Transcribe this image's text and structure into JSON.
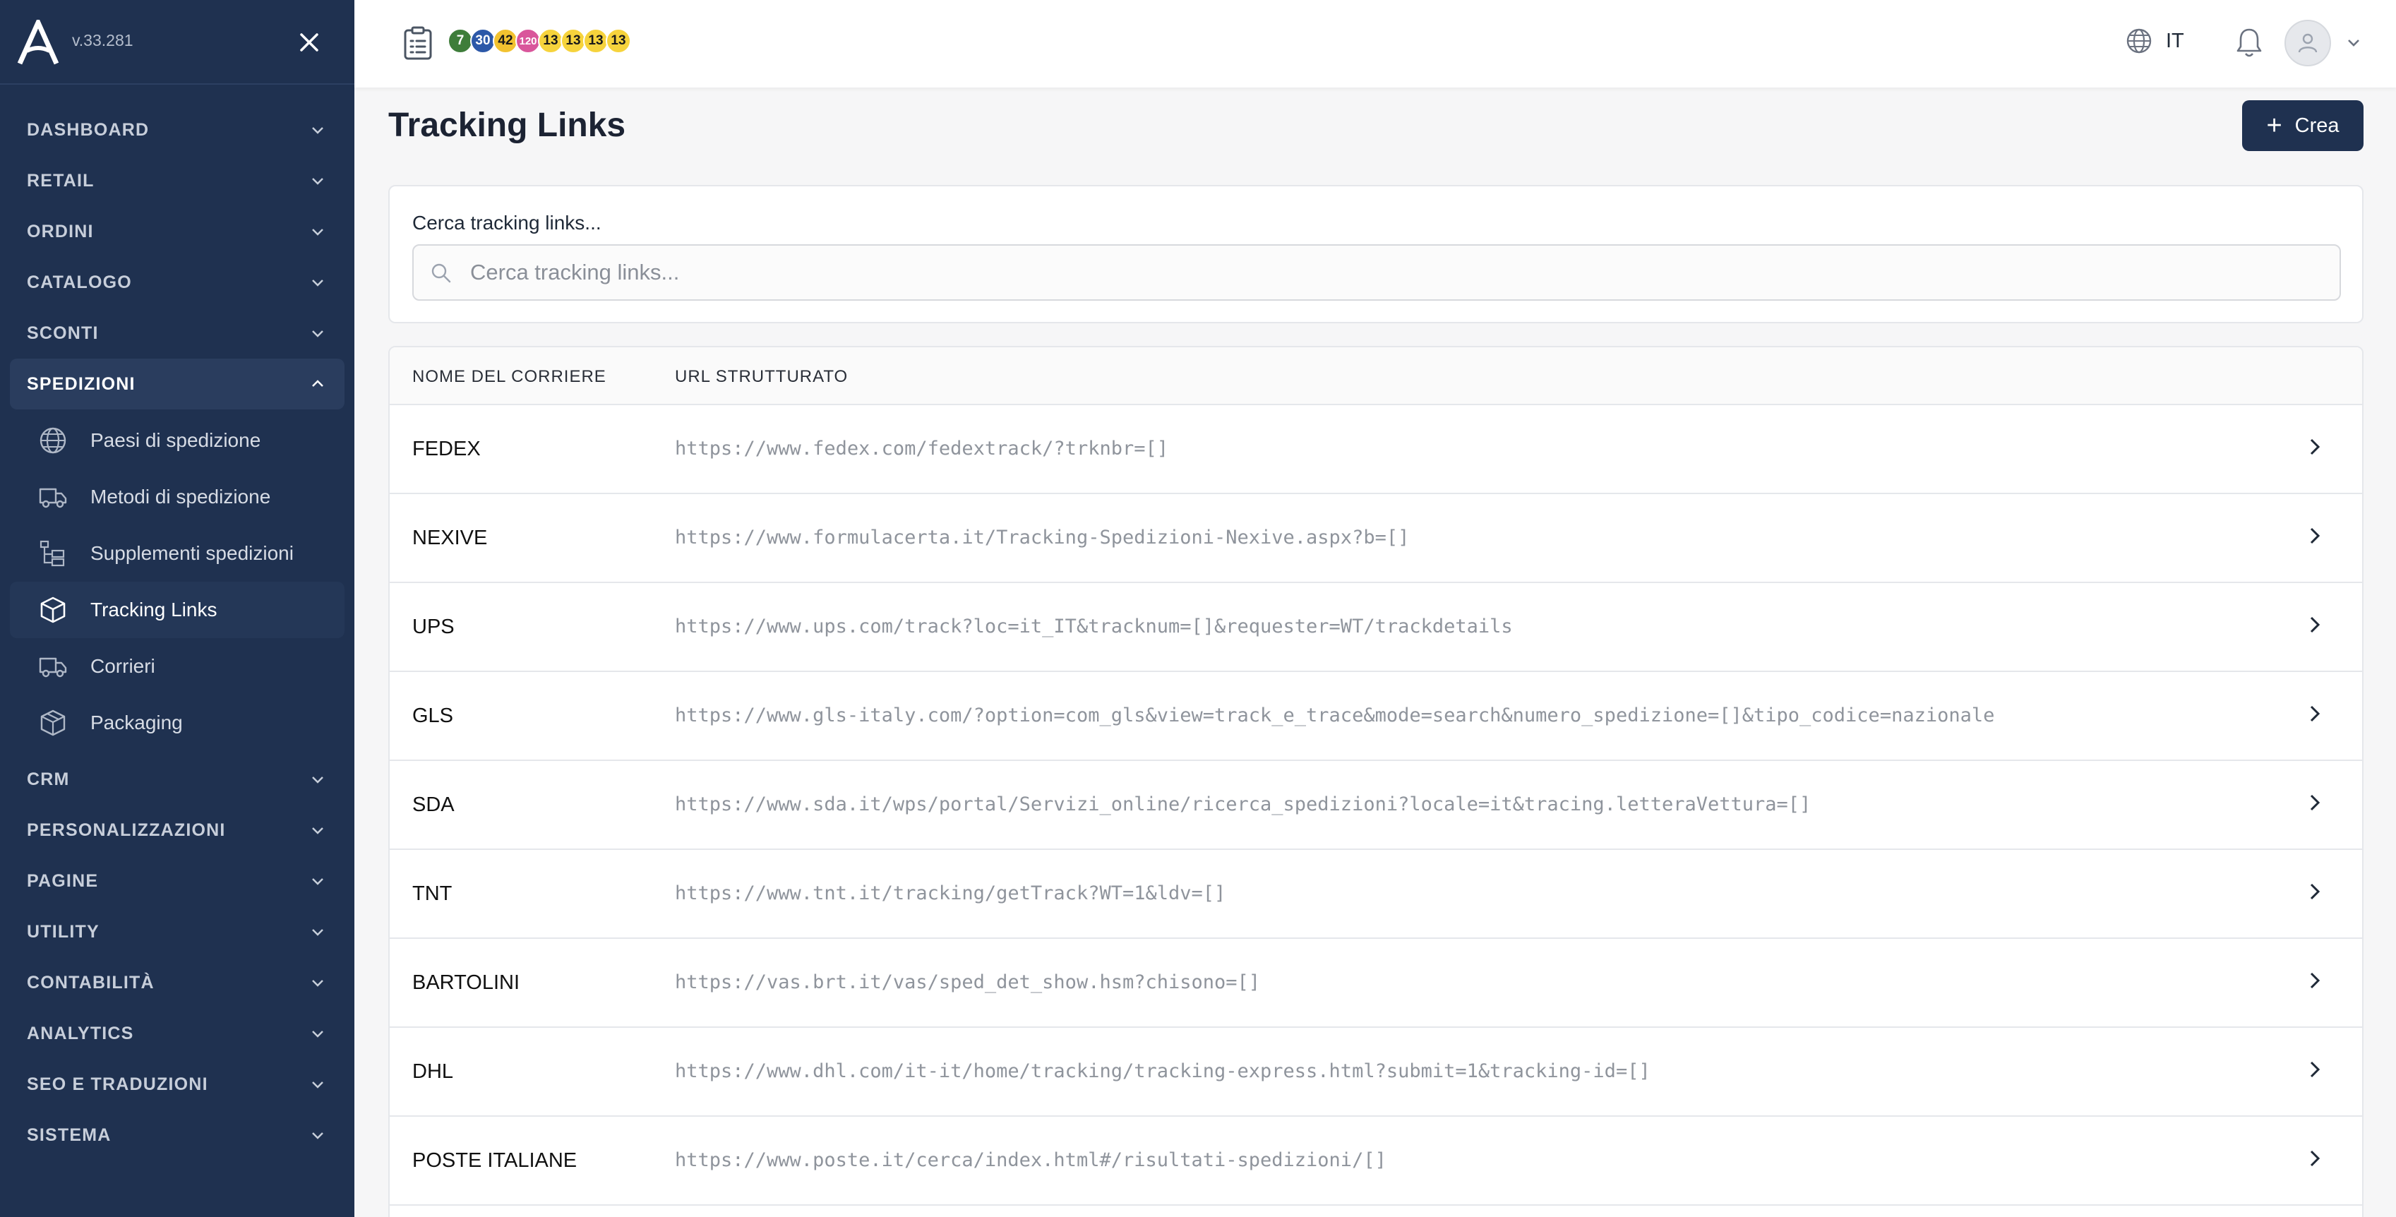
{
  "app": {
    "version": "v.33.281"
  },
  "sidebar": {
    "top_items": [
      {
        "label": "DASHBOARD"
      },
      {
        "label": "RETAIL"
      },
      {
        "label": "ORDINI"
      },
      {
        "label": "CATALOGO"
      },
      {
        "label": "SCONTI"
      }
    ],
    "open_item": {
      "label": "SPEDIZIONI"
    },
    "sub_items": [
      {
        "label": "Paesi di spedizione",
        "icon": "globe-icon"
      },
      {
        "label": "Metodi di spedizione",
        "icon": "truck-icon"
      },
      {
        "label": "Supplementi spedizioni",
        "icon": "hierarchy-icon"
      },
      {
        "label": "Tracking Links",
        "icon": "box-icon",
        "active": true
      },
      {
        "label": "Corrieri",
        "icon": "truck-icon"
      },
      {
        "label": "Packaging",
        "icon": "package-icon"
      }
    ],
    "bottom_items": [
      {
        "label": "CRM"
      },
      {
        "label": "PERSONALIZZAZIONI"
      },
      {
        "label": "PAGINE"
      },
      {
        "label": "UTILITY"
      },
      {
        "label": "CONTABILITÀ"
      },
      {
        "label": "ANALYTICS"
      },
      {
        "label": "SEO E TRADUZIONI"
      },
      {
        "label": "SISTEMA"
      }
    ]
  },
  "topbar": {
    "badges": [
      {
        "value": "7",
        "color": "#3e7d3a",
        "text_color": "#ffffff"
      },
      {
        "value": "30",
        "color": "#2c58a8",
        "text_color": "#ffffff"
      },
      {
        "value": "42",
        "color": "#f2c230",
        "text_color": "#1a1a1a"
      },
      {
        "value": "120",
        "color": "#d9569b",
        "text_color": "#ffffff"
      },
      {
        "value": "13",
        "color": "#f6d33c",
        "text_color": "#1a1a1a"
      },
      {
        "value": "13",
        "color": "#f6d33c",
        "text_color": "#1a1a1a"
      },
      {
        "value": "13",
        "color": "#f6d33c",
        "text_color": "#1a1a1a"
      },
      {
        "value": "13",
        "color": "#f6d33c",
        "text_color": "#1a1a1a"
      }
    ],
    "language": "IT"
  },
  "main": {
    "title": "Tracking Links",
    "create_label": "Crea",
    "search": {
      "label": "Cerca tracking links...",
      "placeholder": "Cerca tracking links..."
    },
    "table": {
      "columns": [
        "NOME DEL CORRIERE",
        "URL STRUTTURATO"
      ],
      "rows": [
        {
          "name": "FEDEX",
          "url": "https://www.fedex.com/fedextrack/?trknbr=[]"
        },
        {
          "name": "NEXIVE",
          "url": "https://www.formulacerta.it/Tracking-Spedizioni-Nexive.aspx?b=[]"
        },
        {
          "name": "UPS",
          "url": "https://www.ups.com/track?loc=it_IT&tracknum=[]&requester=WT/trackdetails"
        },
        {
          "name": "GLS",
          "url": "https://www.gls-italy.com/?option=com_gls&view=track_e_trace&mode=search&numero_spedizione=[]&tipo_codice=nazionale"
        },
        {
          "name": "SDA",
          "url": "https://www.sda.it/wps/portal/Servizi_online/ricerca_spedizioni?locale=it&tracing.letteraVettura=[]"
        },
        {
          "name": "TNT",
          "url": "https://www.tnt.it/tracking/getTrack?WT=1&ldv=[]"
        },
        {
          "name": "BARTOLINI",
          "url": "https://vas.brt.it/vas/sped_det_show.hsm?chisono=[]"
        },
        {
          "name": "DHL",
          "url": "https://www.dhl.com/it-it/home/tracking/tracking-express.html?submit=1&tracking-id=[]"
        },
        {
          "name": "POSTE ITALIANE",
          "url": "https://www.poste.it/cerca/index.html#/risultati-spedizioni/[]"
        }
      ]
    }
  }
}
